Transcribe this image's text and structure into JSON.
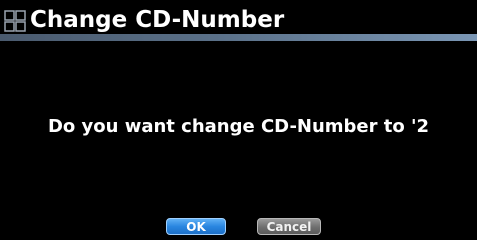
{
  "dialog": {
    "title": "Change CD-Number",
    "title_icon": "grid-icon",
    "message": "Do you want change CD-Number to '2",
    "buttons": {
      "ok_label": "OK",
      "cancel_label": "Cancel"
    }
  },
  "colors": {
    "background": "#000000",
    "text": "#ffffff",
    "title_underline": "#5a7088",
    "ok_button": "#2a86e0",
    "cancel_button": "#6e6e6e"
  }
}
